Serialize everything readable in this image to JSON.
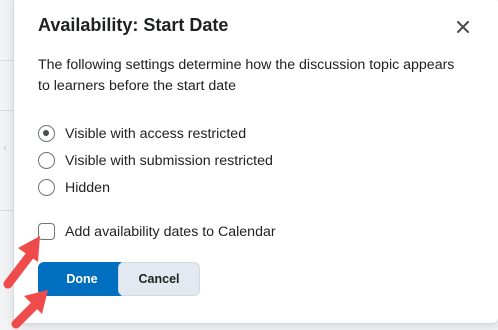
{
  "dialog": {
    "title": "Availability: Start Date",
    "close_icon": "close-icon",
    "description": "The following settings determine how the discussion topic appears to learners before the start date",
    "options": [
      {
        "label": "Visible with access restricted",
        "selected": true
      },
      {
        "label": "Visible with submission restricted",
        "selected": false
      },
      {
        "label": "Hidden",
        "selected": false
      }
    ],
    "calendar_checkbox": {
      "label": "Add availability dates to Calendar",
      "checked": false
    },
    "buttons": {
      "done": "Done",
      "cancel": "Cancel"
    }
  },
  "annotations": {
    "arrow_color": "#f04b4b"
  },
  "colors": {
    "primary": "#006fbf",
    "secondary": "#e3e9f1"
  }
}
